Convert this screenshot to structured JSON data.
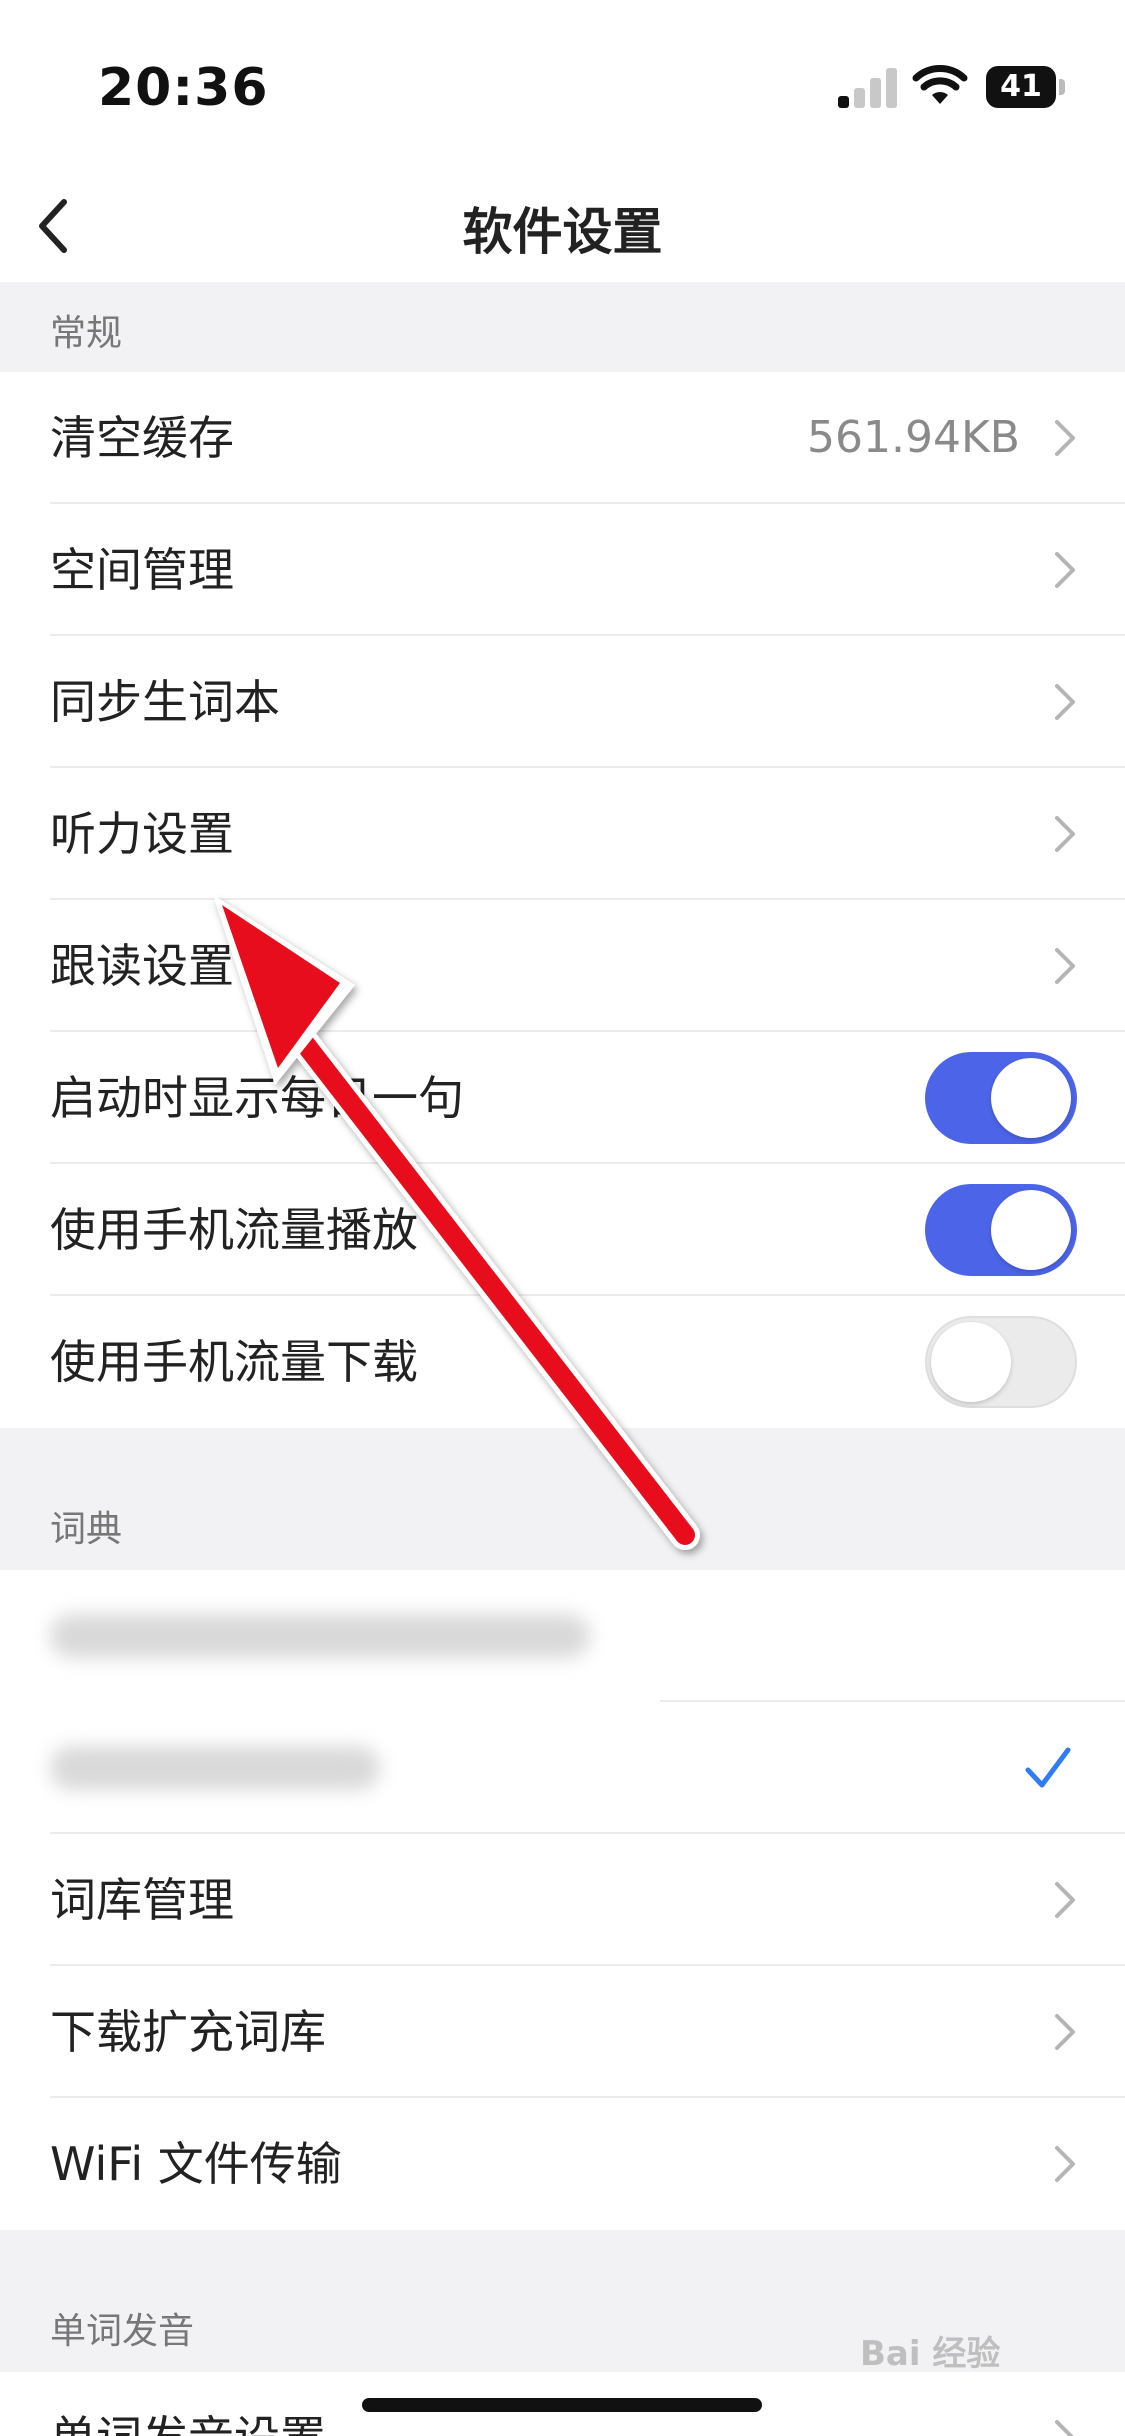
{
  "status_bar": {
    "time": "20:36",
    "battery": "41"
  },
  "navbar": {
    "title": "软件设置"
  },
  "sections": {
    "general": {
      "header": "常规",
      "clear_cache": {
        "label": "清空缓存",
        "value": "561.94KB"
      },
      "space_management": {
        "label": "空间管理"
      },
      "sync_wordbook": {
        "label": "同步生词本"
      },
      "listening_settings": {
        "label": "听力设置"
      },
      "follow_reading_settings": {
        "label": "跟读设置"
      },
      "daily_sentence": {
        "label": "启动时显示每日一句",
        "enabled": true
      },
      "mobile_data_play": {
        "label": "使用手机流量播放",
        "enabled": true
      },
      "mobile_data_download": {
        "label": "使用手机流量下载",
        "enabled": false
      }
    },
    "dictionary": {
      "header": "词典",
      "dictionary_library": {
        "label": "词库管理"
      },
      "download_expand": {
        "label": "下载扩充词库"
      },
      "wifi_transfer": {
        "label": "WiFi 文件传输"
      }
    },
    "pronunciation": {
      "header": "单词发音",
      "pronunciation_settings": {
        "label": "单词发音设置"
      }
    }
  },
  "watermark": "Bai 经验",
  "colors": {
    "accent": "#4c65e8",
    "check": "#2f7df6",
    "annotation_arrow": "#e8101a"
  },
  "icons": [
    "back-chevron-icon",
    "chevron-right-icon",
    "checkmark-icon",
    "wifi-icon",
    "signal-icon",
    "battery-icon"
  ]
}
